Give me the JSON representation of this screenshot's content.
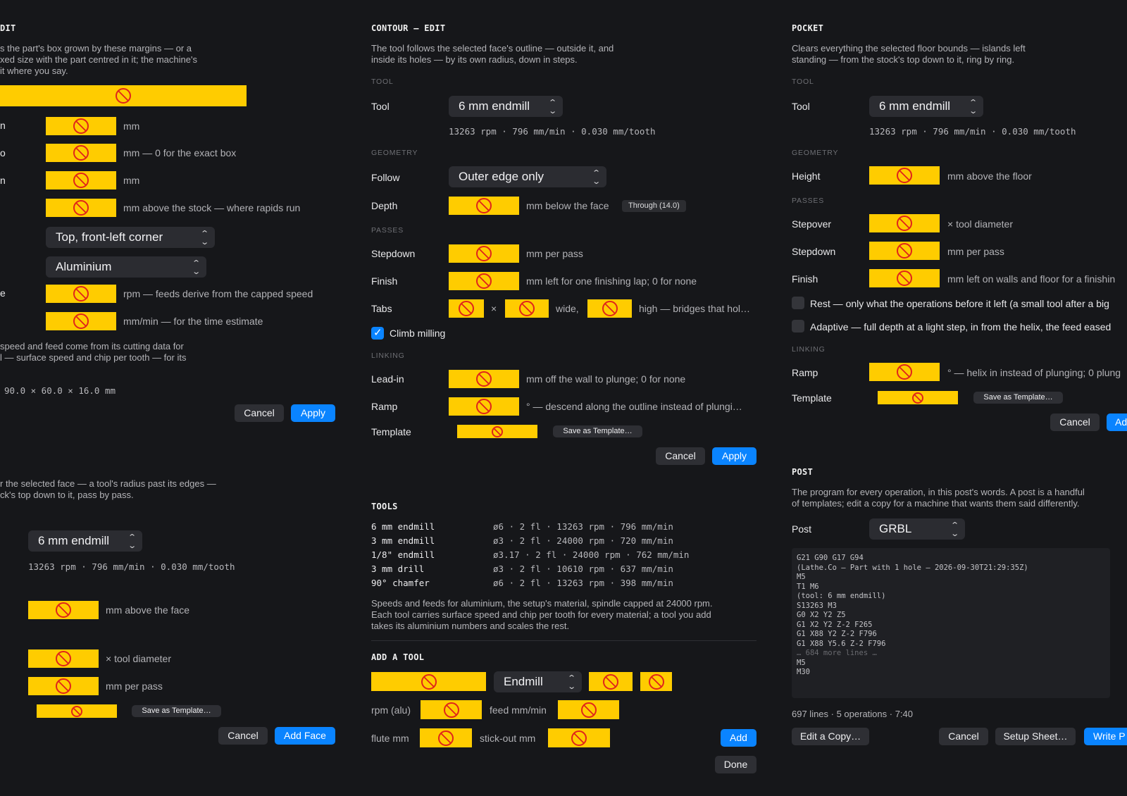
{
  "stock": {
    "title": "DIT",
    "desc1": "s the part's box grown by these margins — or a",
    "desc2": "xed size with the part centred in it; the machine's",
    "desc3": "it where you say.",
    "labels": {
      "row1": "n",
      "row2": "o",
      "row3": "n",
      "row4": "e"
    },
    "hints": {
      "mm1": "mm",
      "exact": "mm — 0 for the exact box",
      "mm3": "mm",
      "above_stock": "mm above the stock — where rapids run",
      "rpm": "rpm — feeds derive from the capped speed",
      "mm_min": "mm/min — for the time estimate"
    },
    "origin_select": "Top, front-left corner",
    "material_select": "Aluminium",
    "note1": "speed and feed come from its cutting data for",
    "note2": "l — surface speed and chip per tooth — for its",
    "size": "90.0 × 60.0 × 16.0 mm",
    "cancel": "Cancel",
    "apply": "Apply"
  },
  "face": {
    "desc1": "r the selected face — a tool's radius past its edges —",
    "desc2": "ck's top down to it, pass by pass.",
    "tool_select": "6 mm endmill",
    "speeds": "13263 rpm · 796 mm/min · 0.030 mm/tooth",
    "hint_above": "mm above the face",
    "hint_dia": "× tool diameter",
    "hint_pass": "mm per pass",
    "save_template": "Save as Template…",
    "cancel": "Cancel",
    "add": "Add Face"
  },
  "contour": {
    "title": "CONTOUR — EDIT",
    "desc1": "The tool follows the selected face's outline — outside it, and",
    "desc2": "inside its holes — by its own radius, down in steps.",
    "sec_tool": "TOOL",
    "tool_label": "Tool",
    "tool_select": "6 mm endmill",
    "speeds": "13263 rpm · 796 mm/min · 0.030 mm/tooth",
    "sec_geometry": "GEOMETRY",
    "follow_label": "Follow",
    "follow_select": "Outer edge only",
    "depth_label": "Depth",
    "depth_hint": "mm below the face",
    "through_badge": "Through (14.0)",
    "sec_passes": "PASSES",
    "stepdown_label": "Stepdown",
    "stepdown_hint": "mm per pass",
    "finish_label": "Finish",
    "finish_hint": "mm left for one finishing lap; 0 for none",
    "tabs_label": "Tabs",
    "tabs_x": "×",
    "tabs_wide": "wide,",
    "tabs_high": "high — bridges that hol…",
    "climb_label": "Climb milling",
    "sec_linking": "LINKING",
    "leadin_label": "Lead-in",
    "leadin_hint": "mm off the wall to plunge; 0 for none",
    "ramp_label": "Ramp",
    "ramp_hint": "° — descend along the outline instead of plungi…",
    "template_label": "Template",
    "save_template": "Save as Template…",
    "cancel": "Cancel",
    "apply": "Apply"
  },
  "tools": {
    "title": "TOOLS",
    "rows": [
      {
        "name": "6 mm endmill",
        "spec": "ø6 · 2 fl · 13263 rpm · 796 mm/min"
      },
      {
        "name": "3 mm endmill",
        "spec": "ø3 · 2 fl · 24000 rpm · 720 mm/min"
      },
      {
        "name": "1/8\" endmill",
        "spec": "ø3.17 · 2 fl · 24000 rpm · 762 mm/min"
      },
      {
        "name": "3 mm drill",
        "spec": "ø3 · 2 fl · 10610 rpm · 637 mm/min"
      },
      {
        "name": "90° chamfer",
        "spec": "ø6 · 2 fl · 13263 rpm · 398 mm/min"
      }
    ],
    "note1": "Speeds and feeds for aluminium, the setup's material, spindle capped at 24000 rpm.",
    "note2": "Each tool carries surface speed and chip per tooth for every material; a tool you add",
    "note3": "takes its aluminium numbers and scales the rest.",
    "add_title": "ADD A TOOL",
    "type_select": "Endmill",
    "rpm_label": "rpm (alu)",
    "feed_label": "feed mm/min",
    "flute_label": "flute mm",
    "stickout_label": "stick-out mm",
    "add": "Add",
    "done": "Done"
  },
  "pocket": {
    "title": "POCKET",
    "desc1": "Clears everything the selected floor bounds — islands left",
    "desc2": "standing — from the stock's top down to it, ring by ring.",
    "sec_tool": "TOOL",
    "tool_label": "Tool",
    "tool_select": "6 mm endmill",
    "speeds": "13263 rpm · 796 mm/min · 0.030 mm/tooth",
    "sec_geometry": "GEOMETRY",
    "height_label": "Height",
    "height_hint": "mm above the floor",
    "sec_passes": "PASSES",
    "stepover_label": "Stepover",
    "stepover_hint": "× tool diameter",
    "stepdown_label": "Stepdown",
    "stepdown_hint": "mm per pass",
    "finish_label": "Finish",
    "finish_hint": "mm left on walls and floor for a finishin",
    "rest_label": "Rest — only what the operations before it left (a small tool after a big",
    "adaptive_label": "Adaptive — full depth at a light step, in from the helix, the feed eased",
    "sec_linking": "LINKING",
    "ramp_label": "Ramp",
    "ramp_hint": "° — helix in instead of plunging; 0 plung",
    "template_label": "Template",
    "save_template": "Save as Template…",
    "cancel": "Cancel",
    "add": "Ad"
  },
  "post": {
    "title": "POST",
    "desc1": "The program for every operation, in this post's words. A post is a handful",
    "desc2": "of templates; edit a copy for a machine that wants them said differently.",
    "post_label": "Post",
    "post_select": "GRBL",
    "code": [
      "G21 G90 G17 G94",
      "(Lathe.Co — Part with 1 hole — 2026-09-30T21:29:35Z)",
      "M5",
      "T1 M6",
      "(tool: 6 mm endmill)",
      "S13263 M3",
      "G0 X2 Y2 Z5",
      "G1 X2 Y2 Z-2 F265",
      "G1 X88 Y2 Z-2 F796",
      "G1 X88 Y5.6 Z-2 F796"
    ],
    "more_lines": "… 684 more lines …",
    "code_end": [
      "M5",
      "M30"
    ],
    "stats": "697 lines · 5 operations · 7:40",
    "edit_copy": "Edit a Copy…",
    "cancel": "Cancel",
    "setup_sheet": "Setup Sheet…",
    "write": "Write P"
  }
}
